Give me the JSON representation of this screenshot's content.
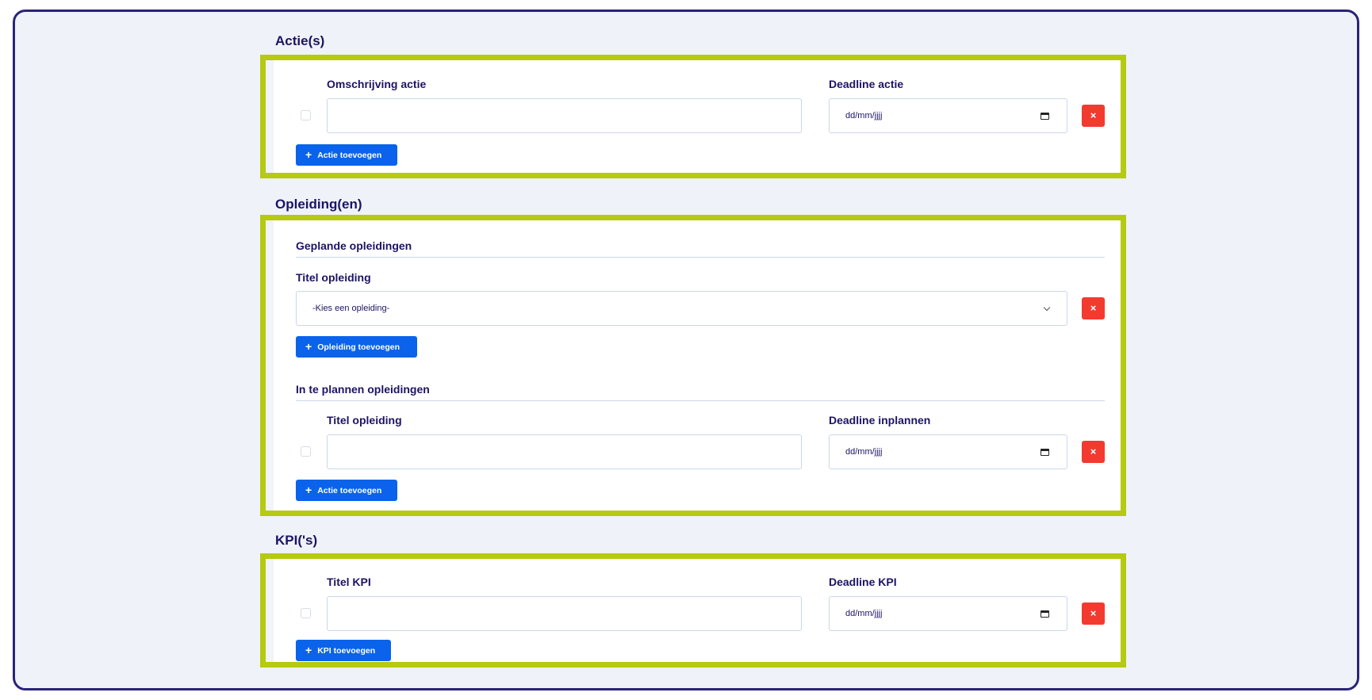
{
  "acties": {
    "title": "Actie(s)",
    "desc_label": "Omschrijving actie",
    "deadline_label": "Deadline actie",
    "date_placeholder": "dd/mm/jjjj",
    "delete_icon": "×",
    "add_label": "Actie toevoegen"
  },
  "opleidingen": {
    "title": "Opleiding(en)",
    "geplande": {
      "heading": "Geplande opleidingen",
      "title_label": "Titel opleiding",
      "select_value": "-Kies een opleiding-",
      "delete_icon": "×",
      "add_label": "Opleiding toevoegen"
    },
    "in_te_plannen": {
      "heading": "In te plannen opleidingen",
      "title_label": "Titel opleiding",
      "deadline_label": "Deadline inplannen",
      "date_placeholder": "dd/mm/jjjj",
      "delete_icon": "×",
      "add_label": "Actie toevoegen"
    }
  },
  "kpis": {
    "title": "KPI('s)",
    "title_label": "Titel KPI",
    "deadline_label": "Deadline KPI",
    "date_placeholder": "dd/mm/jjjj",
    "delete_icon": "×",
    "add_label": "KPI toevoegen"
  },
  "icons": {
    "plus": "+",
    "delete": "close-icon",
    "calendar": "calendar-icon",
    "chevron": "chevron-down-icon"
  },
  "colors": {
    "accent_border": "#b5ca10",
    "primary_button": "#0a63ea",
    "danger_button": "#f23a2f",
    "heading_text": "#1b1464",
    "frame_border": "#2a2478"
  }
}
